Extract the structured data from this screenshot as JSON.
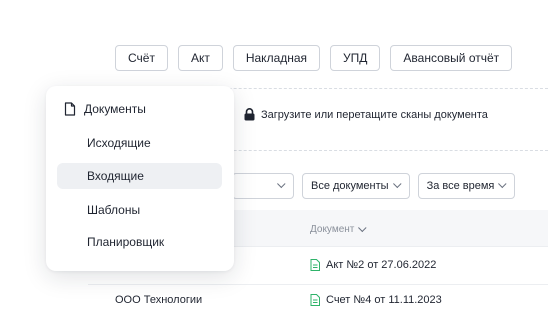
{
  "toolbar": {
    "buttons": [
      "Счёт",
      "Акт",
      "Накладная",
      "УПД",
      "Авансовый отчёт"
    ]
  },
  "upload": {
    "text": "Загрузите или перетащите сканы документа",
    "icon": "lock-icon"
  },
  "filters": {
    "first_value": "",
    "documents": "Все документы",
    "period": "За все время"
  },
  "table": {
    "doc_header": "Документ",
    "rows": [
      {
        "counterparty": "",
        "document": "Акт №2 от 27.06.2022"
      },
      {
        "counterparty": "ООО Технологии",
        "document": "Счет №4 от 11.11.2023"
      }
    ]
  },
  "menu": {
    "title": "Документы",
    "items": [
      "Исходящие",
      "Входящие",
      "Шаблоны",
      "Планировщик"
    ],
    "active_index": 1
  },
  "colors": {
    "file_icon": "#2fb36a",
    "active_item_bg": "#eef0f3"
  }
}
